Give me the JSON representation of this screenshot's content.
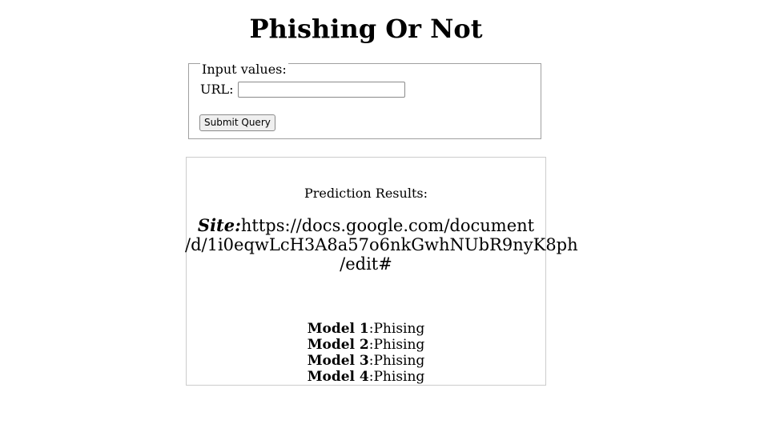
{
  "header": {
    "title": "Phishing Or Not"
  },
  "form": {
    "legend": "Input values:",
    "url_label": "URL:",
    "url_value": "",
    "submit_label": "Submit Query"
  },
  "results": {
    "heading": "Prediction Results:",
    "site_label": "Site:",
    "site_url_line1": "https://docs.google.com/document",
    "site_url_line2": "/d/1i0eqwLcH3A8a57o6nkGwhNUbR9nyK8ph",
    "site_url_line3": "/edit#",
    "models": [
      {
        "name": "Model 1",
        "result": ":Phising"
      },
      {
        "name": "Model 2",
        "result": ":Phising"
      },
      {
        "name": "Model 3",
        "result": ":Phising"
      },
      {
        "name": "Model 4",
        "result": ":Phising"
      }
    ]
  }
}
